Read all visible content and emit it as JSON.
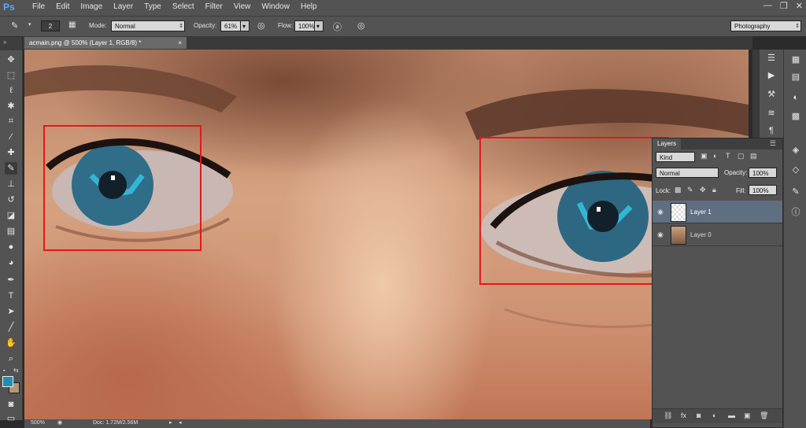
{
  "app": {
    "logo": "Ps"
  },
  "menu": [
    "File",
    "Edit",
    "Image",
    "Layer",
    "Type",
    "Select",
    "Filter",
    "View",
    "Window",
    "Help"
  ],
  "window_controls": {
    "minimize": "—",
    "restore": "❐",
    "close": "✕"
  },
  "options": {
    "brush_size": "2",
    "mode_label": "Mode:",
    "mode_value": "Normal",
    "opacity_label": "Opacity:",
    "opacity_value": "61%",
    "flow_label": "Flow:",
    "flow_value": "100%",
    "workspace": "Photography"
  },
  "document": {
    "tab_title": "acmain.png @ 500% (Layer 1, RGB/8) *",
    "close": "×"
  },
  "status": {
    "zoom": "500%",
    "doc_info": "Doc: 1.72M/2.56M"
  },
  "layers_panel": {
    "title": "Layers",
    "kind_filter": "Kind",
    "blend_mode": "Normal",
    "opacity_label": "Opacity:",
    "opacity_value": "100%",
    "lock_label": "Lock:",
    "fill_label": "Fill:",
    "fill_value": "100%",
    "layers": [
      {
        "name": "Layer 1",
        "selected": true
      },
      {
        "name": "Layer 0",
        "selected": false
      }
    ],
    "footer_icons": [
      "link-icon",
      "fx-icon",
      "mask-icon",
      "adjustment-icon",
      "group-icon",
      "new-layer-icon",
      "trash-icon"
    ]
  },
  "colors": {
    "foreground": "#1f8fb0",
    "background": "#b59575",
    "highlight_box": "#e0191e",
    "iris": "#2f6d88",
    "iris_highlight": "#33b6d6"
  },
  "tools": [
    "move-icon",
    "marquee-icon",
    "lasso-icon",
    "quick-select-icon",
    "crop-icon",
    "eyedropper-icon",
    "healing-icon",
    "brush-icon",
    "clone-stamp-icon",
    "history-brush-icon",
    "eraser-icon",
    "gradient-icon",
    "blur-icon",
    "dodge-icon",
    "pen-icon",
    "type-icon",
    "path-select-icon",
    "line-icon",
    "hand-icon",
    "zoom-icon"
  ]
}
